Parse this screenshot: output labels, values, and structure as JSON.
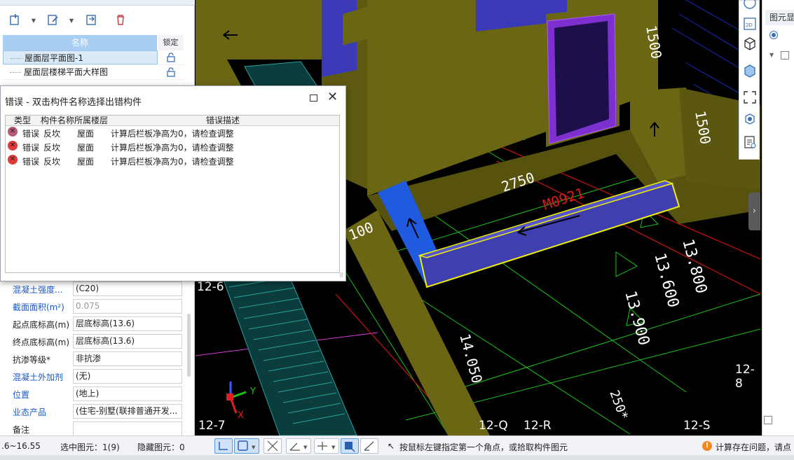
{
  "drawing_list": {
    "header_name": "名称",
    "header_lock": "锁定",
    "rows": [
      {
        "name": "屋面层平面图-1",
        "selected": true
      },
      {
        "name": "屋面层楼梯平面大样图",
        "selected": false
      }
    ]
  },
  "properties": [
    {
      "label": "混凝土强度...",
      "value": "(C20)",
      "label_blue": true,
      "value_grey": false
    },
    {
      "label": "截面面积(m²)",
      "value": "0.075",
      "label_blue": true,
      "value_grey": true
    },
    {
      "label": "起点底标高(m)",
      "value": "层底标高(13.6)",
      "label_blue": false,
      "value_grey": false
    },
    {
      "label": "终点底标高(m)",
      "value": "层底标高(13.6)",
      "label_blue": false,
      "value_grey": false
    },
    {
      "label": "抗渗等级*",
      "value": "非抗渗",
      "label_blue": false,
      "value_grey": false
    },
    {
      "label": "混凝土外加剂",
      "value": "(无)",
      "label_blue": true,
      "value_grey": false
    },
    {
      "label": "位置",
      "value": "(地上)",
      "label_blue": true,
      "value_grey": false
    },
    {
      "label": "业态产品",
      "value": "(住宅-别墅(联排普通开发...",
      "label_blue": true,
      "value_grey": false
    },
    {
      "label": "备注",
      "value": "",
      "label_blue": false,
      "value_grey": false
    }
  ],
  "error_dialog": {
    "title": "错误 - 双击构件名称选择出错构件",
    "columns": [
      "类型",
      "构件名称",
      "所属楼层",
      "错误描述"
    ],
    "rows": [
      {
        "type": "错误",
        "name": "反坎",
        "floor": "屋面",
        "desc": "计算后栏板净高为0，请检查调整"
      },
      {
        "type": "错误",
        "name": "反坎",
        "floor": "屋面",
        "desc": "计算后栏板净高为0，请检查调整"
      },
      {
        "type": "错误",
        "name": "反坎",
        "floor": "屋面",
        "desc": "计算后栏板净高为0，请检查调整"
      }
    ]
  },
  "viewport_labels": {
    "dim_2750": "2750",
    "door_tag": "M0921",
    "dim_100": "100",
    "dim_1500a": "1500",
    "dim_1500b": "1500",
    "elev_13800": "13.800",
    "elev_13600": "13.600",
    "elev_13900": "13.900",
    "elev_14050": "14.050",
    "grid_12_6": "12-6",
    "grid_12_7": "12-7",
    "grid_12_Q": "12-Q",
    "grid_12_R": "12-R",
    "grid_12_S": "12-S",
    "grid_12_8": "12-8",
    "note_250": "250*",
    "axis_y": "Y",
    "axis_x": "X"
  },
  "right_panel": {
    "header": "图元显"
  },
  "statusbar": {
    "range": ".6~16.55",
    "selected": "选中图元：1(9)",
    "hidden": "隐藏图元：0",
    "hint": "按鼠标左键指定第一个角点，或拾取构件图元",
    "warning": "计算存在问题，请点"
  },
  "colors": {
    "viewport_bg": "#000000",
    "wall_olive": "#6b6614",
    "member_blue": "#3f3fb0",
    "selection_yellow": "#f0f000",
    "dim_green": "#19c419",
    "error_red": "#e03a3a"
  }
}
